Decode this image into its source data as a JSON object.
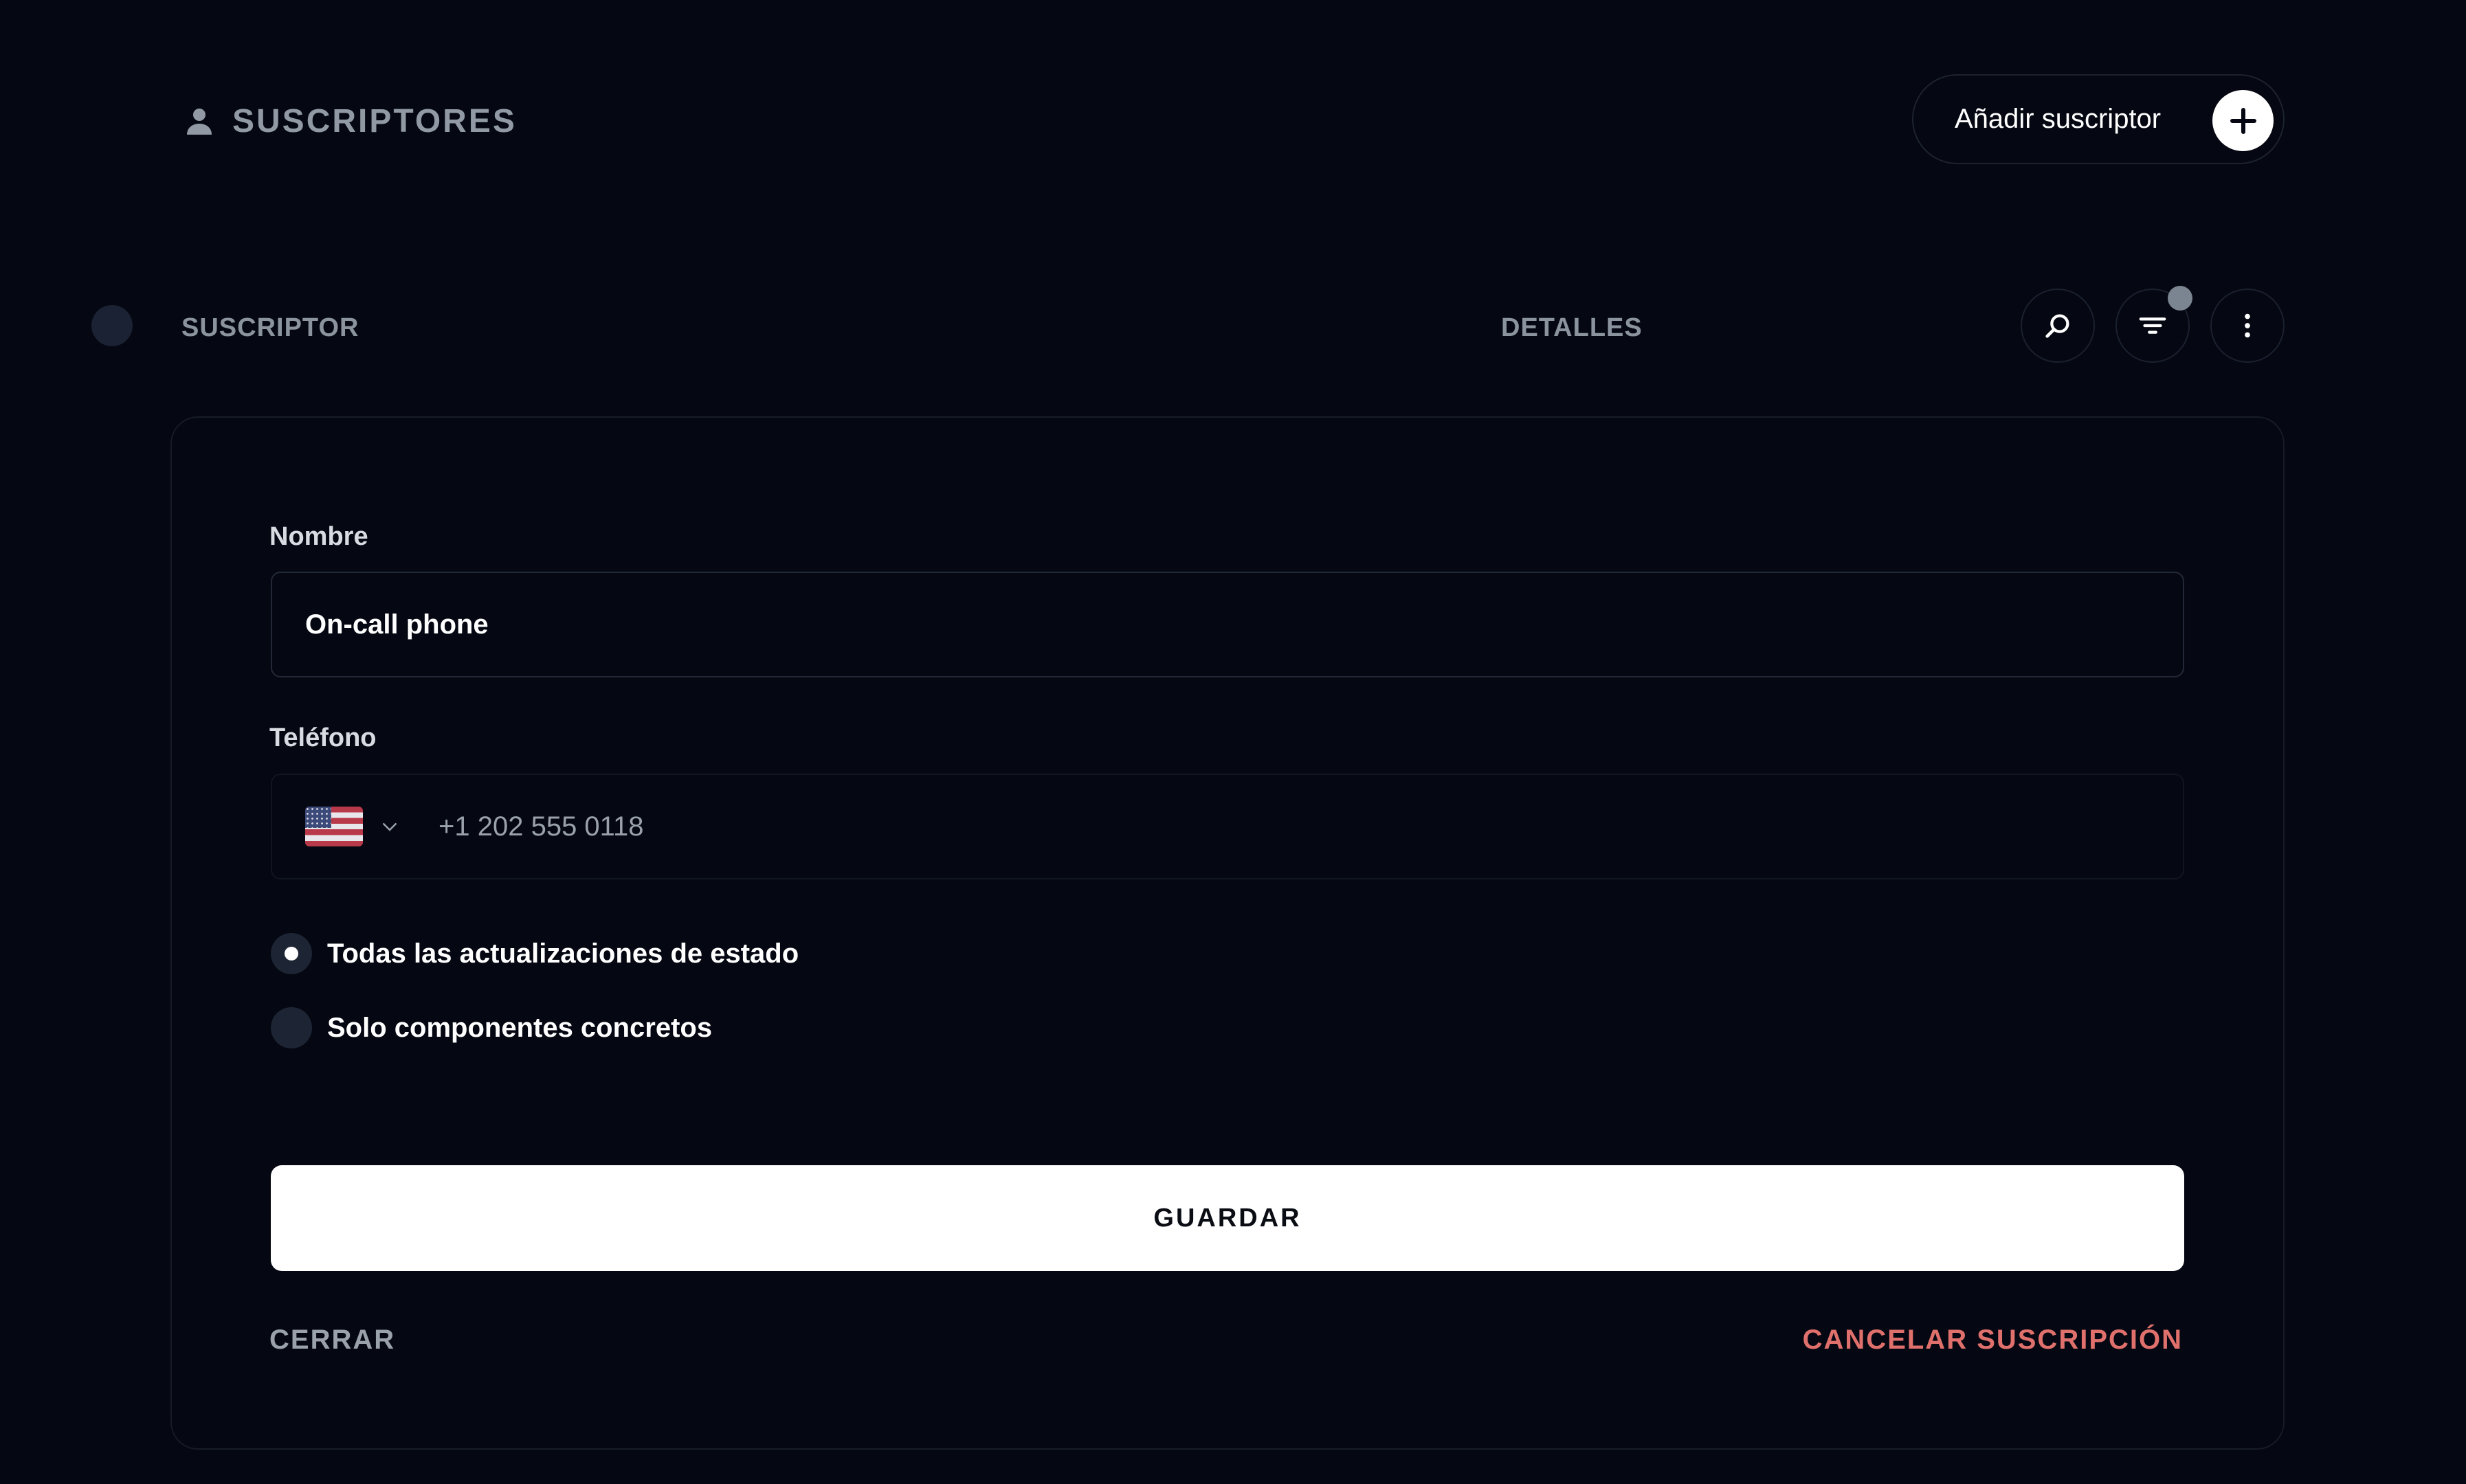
{
  "header": {
    "title": "SUSCRIPTORES",
    "add_button_label": "Añadir suscriptor"
  },
  "table_header": {
    "col_subscriber": "SUSCRIPTOR",
    "col_details": "DETALLES"
  },
  "form": {
    "name_label": "Nombre",
    "name_value": "On-call phone",
    "phone_label": "Teléfono",
    "phone_country": "us-flag-icon",
    "phone_value": "+1 202 555 0118",
    "radio_all_label": "Todas las actualizaciones de estado",
    "radio_specific_label": "Solo componentes concretos",
    "selected_option": "all",
    "save_label": "GUARDAR",
    "close_label": "CERRAR",
    "unsubscribe_label": "CANCELAR SUSCRIPCIÓN"
  },
  "colors": {
    "background": "#050812",
    "danger": "#e0706c",
    "muted": "#9aa1ab"
  }
}
